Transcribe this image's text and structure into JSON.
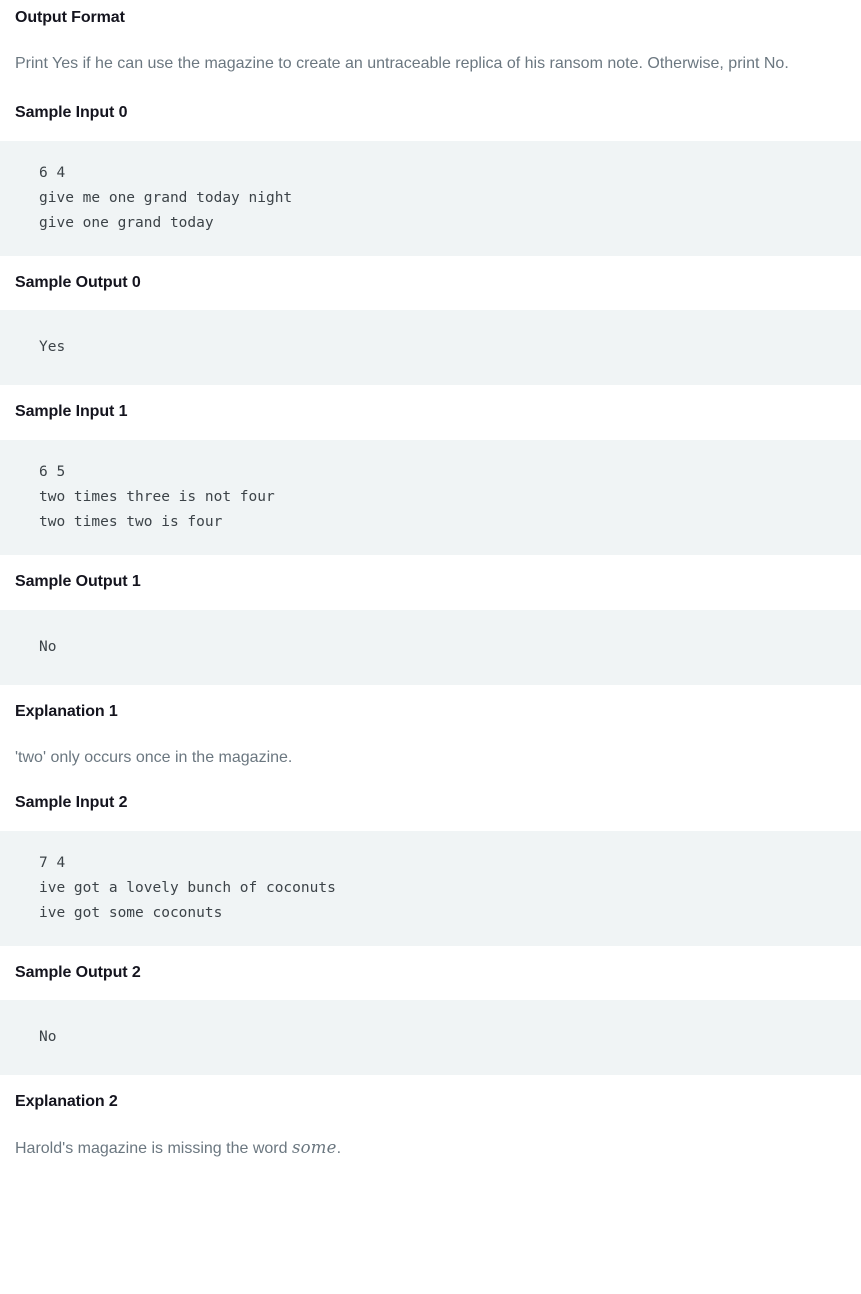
{
  "document": {
    "sections": [
      {
        "id": "output-format",
        "heading": "Output Format",
        "paragraph": "Print Yes if he can use the magazine to create an untraceable replica of his ransom note. Otherwise, print No."
      },
      {
        "id": "sample-input-0",
        "heading": "Sample Input 0",
        "code": "6 4\ngive me one grand today night\ngive one grand today"
      },
      {
        "id": "sample-output-0",
        "heading": "Sample Output 0",
        "code": "Yes"
      },
      {
        "id": "sample-input-1",
        "heading": "Sample Input 1",
        "code": "6 5\ntwo times three is not four\ntwo times two is four"
      },
      {
        "id": "sample-output-1",
        "heading": "Sample Output 1",
        "code": "No"
      },
      {
        "id": "explanation-1",
        "heading": "Explanation 1",
        "paragraph": "'two' only occurs once in the magazine."
      },
      {
        "id": "sample-input-2",
        "heading": "Sample Input 2",
        "code": "7 4\nive got a lovely bunch of coconuts\nive got some coconuts"
      },
      {
        "id": "sample-output-2",
        "heading": "Sample Output 2",
        "code": "No"
      },
      {
        "id": "explanation-2",
        "heading": "Explanation 2",
        "paragraph_before": "Harold's magazine is missing the word ",
        "paragraph_math": "some",
        "paragraph_after": "."
      }
    ]
  },
  "colors": {
    "heading": "#14141e",
    "body": "#6b7780",
    "code_background": "#f0f4f5",
    "code_text": "#3c4348",
    "page_background": "#ffffff"
  }
}
